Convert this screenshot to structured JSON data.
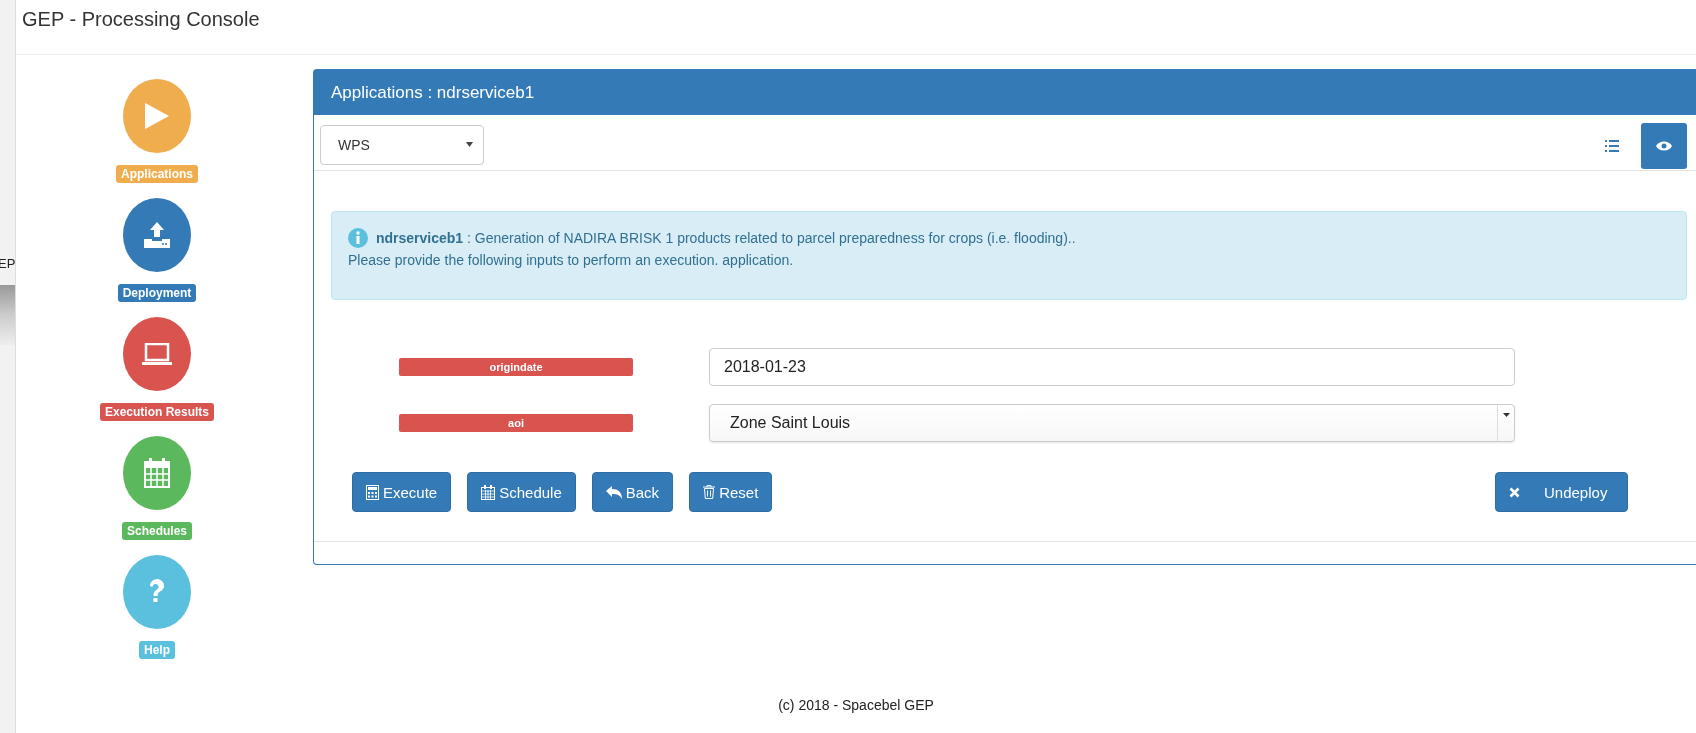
{
  "backdrop": {
    "fragment": "EP"
  },
  "window": {
    "title": "GEP - Processing Console"
  },
  "sidebar": {
    "items": [
      {
        "label": "Applications",
        "kind": "play",
        "color": "#f0ad4e"
      },
      {
        "label": "Deployment",
        "kind": "upload",
        "color": "#337ab7"
      },
      {
        "label": "Execution Results",
        "kind": "laptop",
        "color": "#d9534f"
      },
      {
        "label": "Schedules",
        "kind": "calendar",
        "color": "#5cb85c"
      },
      {
        "label": "Help",
        "kind": "help",
        "color": "#5bc0de"
      }
    ]
  },
  "panel": {
    "title": "Applications : ndrserviceb1",
    "protocol_select": {
      "value": "WPS"
    },
    "view_buttons": [
      {
        "kind": "list",
        "selected": false
      },
      {
        "kind": "eye",
        "selected": true
      }
    ],
    "info": {
      "name": "ndrserviceb1",
      "description": " : Generation of NADIRA BRISK 1 products related to parcel preparedness for crops (i.e. flooding)..",
      "hint": "Please provide the following inputs to perform an execution. application."
    },
    "inputs": [
      {
        "label": "origindate",
        "kind": "text",
        "value": "2018-01-23"
      },
      {
        "label": "aoi",
        "kind": "select",
        "value": "Zone Saint Louis"
      }
    ],
    "buttons": [
      {
        "label": "Execute",
        "kind": "execute"
      },
      {
        "label": "Schedule",
        "kind": "schedule"
      },
      {
        "label": "Back",
        "kind": "back"
      },
      {
        "label": "Reset",
        "kind": "reset"
      },
      {
        "label": "Undeploy",
        "kind": "undeploy"
      }
    ]
  },
  "footer": {
    "text": "(c) 2018 - Spacebel GEP"
  }
}
